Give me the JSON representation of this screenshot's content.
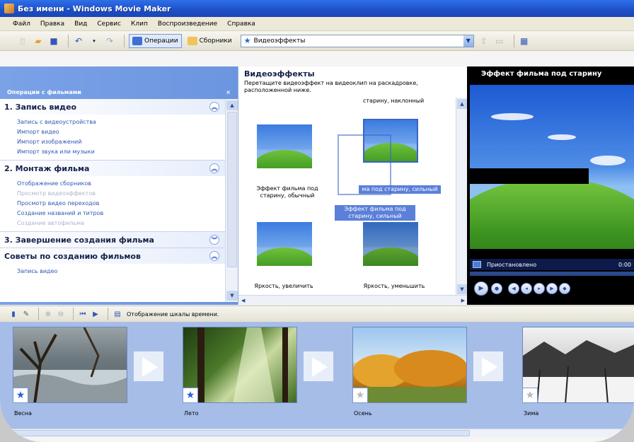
{
  "window": {
    "title": "Без имени - Windows Movie Maker"
  },
  "menu": [
    "Файл",
    "Правка",
    "Вид",
    "Сервис",
    "Клип",
    "Воспроизведение",
    "Справка"
  ],
  "toolbar": {
    "operations_label": "Операции",
    "collections_label": "Сборники",
    "collection_combo_value": "Видеоэффекты"
  },
  "taskpane": {
    "title": "Операции с фильмами",
    "close_glyph": "×",
    "sections": [
      {
        "title": "1. Запись видео",
        "items": [
          "Запись с видеоустройства",
          "Импорт видео",
          "Импорт изображений",
          "Импорт звука или музыки"
        ]
      },
      {
        "title": "2. Монтаж фильма",
        "items": [
          "Отображение сборников",
          "Просмотр видеоэффектов",
          "Просмотр видео переходов",
          "Создание названий и титров",
          "Создание автофильма"
        ]
      },
      {
        "title": "3. Завершение создания фильма",
        "items": []
      },
      {
        "title": "Советы по созданию фильмов",
        "items": [
          "Запись видео"
        ]
      }
    ]
  },
  "effects": {
    "title": "Видеоэффекты",
    "description": "Перетащите видеоэффект на видеоклип на раскадровке, расположенной ниже.",
    "cut_label": "старину, наклонный",
    "items": [
      {
        "label": "Эффект фильма под старину, обычный"
      },
      {
        "label": "ма под старину, сильный"
      },
      {
        "label": "Яркость, увеличить"
      },
      {
        "label": "Яркость, уменьшить"
      }
    ],
    "drag_label": "Эффект фильма под старину, сильный"
  },
  "preview": {
    "title": "Эффект фильма под старину",
    "status": "Приостановлено",
    "time": "0:00"
  },
  "storyboard_toolbar": {
    "timeline_label": "Отображение шкалы времени."
  },
  "storyboard": {
    "clips": [
      {
        "caption": "Весна"
      },
      {
        "caption": "Лето"
      },
      {
        "caption": "Осень"
      },
      {
        "caption": "Зима"
      }
    ]
  }
}
